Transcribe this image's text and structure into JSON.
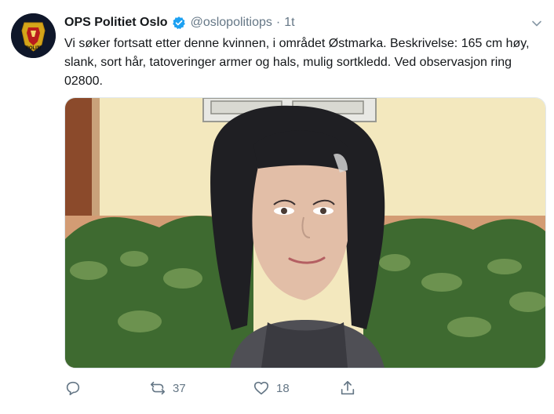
{
  "tweet": {
    "author_name": "OPS Politiet Oslo",
    "handle": "@oslopolitiops",
    "separator": "·",
    "time": "1t",
    "text": "Vi søker fortsatt etter denne kvinnen, i området Østmarka. Beskrivelse: 165 cm høy, slank, sort hår, tatoveringer armer og hals, mulig sortkledd. Ved observasjon ring 02800.",
    "avatar_badge_text": "POLITI"
  },
  "actions": {
    "reply_icon": "comment-icon",
    "retweet_count": "37",
    "like_count": "18",
    "share_icon": "share-icon"
  },
  "colors": {
    "text": "#14171a",
    "secondary": "#657786",
    "verified": "#1da1f2",
    "wall": "#f3e8be",
    "hedge": "#3e6a30"
  }
}
